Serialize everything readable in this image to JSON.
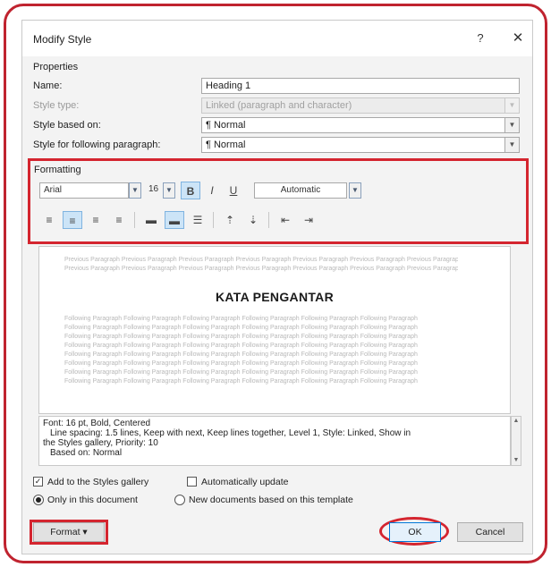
{
  "dialog": {
    "title": "Modify Style",
    "help": "?",
    "close": "✕"
  },
  "properties": {
    "section_label": "Properties",
    "name_label": "Name:",
    "name_value": "Heading 1",
    "style_type_label": "Style type:",
    "style_type_value": "Linked (paragraph and character)",
    "based_on_label": "Style based on:",
    "based_on_value": "¶ Normal",
    "following_label": "Style for following paragraph:",
    "following_value": "¶ Normal"
  },
  "formatting": {
    "section_label": "Formatting",
    "font": "Arial",
    "size": "16",
    "bold": "B",
    "italic": "I",
    "underline": "U",
    "color": "Automatic"
  },
  "preview": {
    "previous_text": "Previous Paragraph Previous Paragraph Previous Paragraph Previous Paragraph Previous Paragraph Previous Paragraph Previous Paragraph Previous Paragraph Previous Paragraph Previous Paragraph",
    "heading": "KATA PENGANTAR",
    "following_text": "Following Paragraph Following Paragraph Following Paragraph Following Paragraph Following Paragraph Following Paragraph"
  },
  "description": {
    "line1": "Font: 16 pt, Bold, Centered",
    "line2": "Line spacing:  1.5 lines, Keep with next, Keep lines together, Level 1, Style: Linked, Show in",
    "line3": "the Styles gallery, Priority: 10",
    "line4": "Based on: Normal"
  },
  "options": {
    "add_gallery": "Add to the Styles gallery",
    "auto_update": "Automatically update",
    "only_doc": "Only in this document",
    "new_docs": "New documents based on this template"
  },
  "buttons": {
    "format": "Format ▾",
    "ok": "OK",
    "cancel": "Cancel"
  },
  "colors": {
    "highlight": "#d4252f",
    "active_tool": "#cce4f7"
  }
}
